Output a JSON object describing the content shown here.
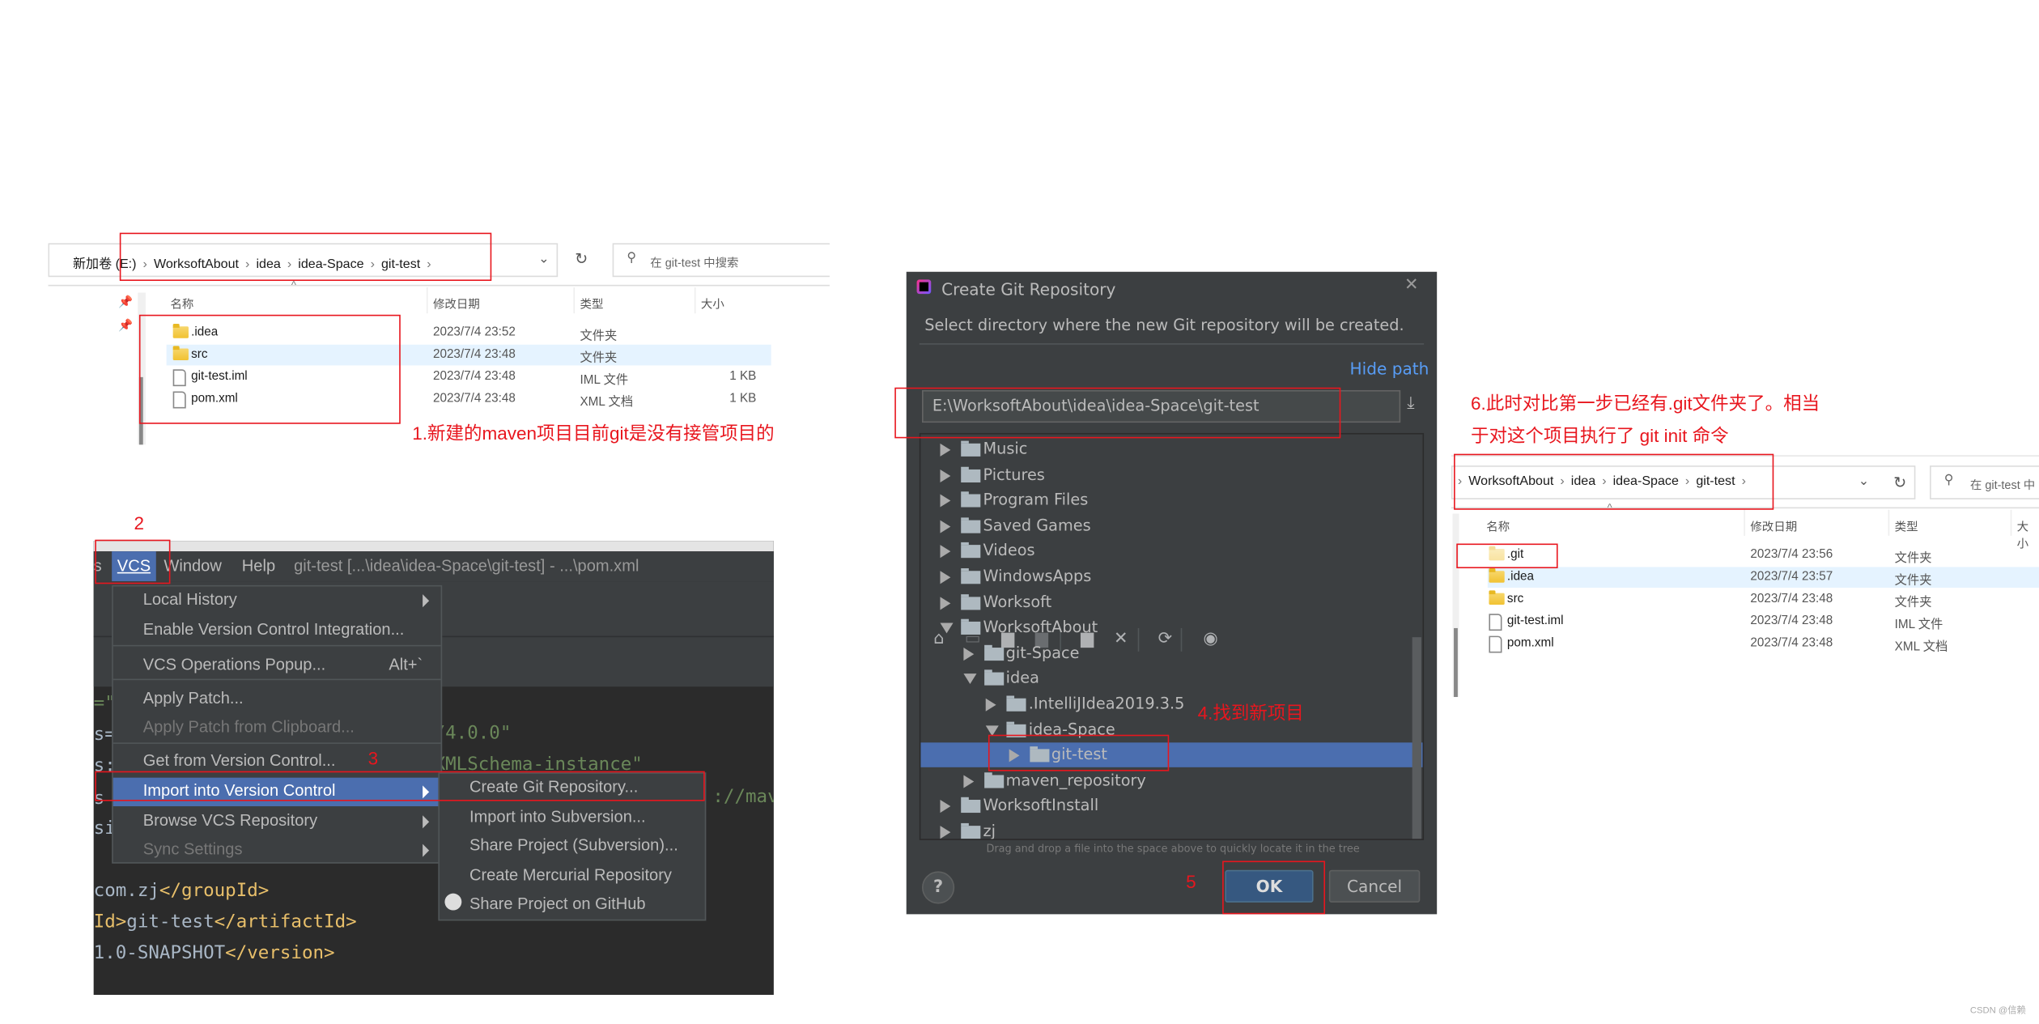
{
  "explorer_before": {
    "breadcrumb": [
      "新加卷 (E:)",
      "WorksoftAbout",
      "idea",
      "idea-Space",
      "git-test"
    ],
    "search_placeholder": "在 git-test 中搜索",
    "columns": [
      "名称",
      "修改日期",
      "类型",
      "大小"
    ],
    "rows": [
      {
        "name": ".idea",
        "date": "2023/7/4 23:52",
        "type": "文件夹",
        "size": "",
        "icon": "folder-icon",
        "selected": false
      },
      {
        "name": "src",
        "date": "2023/7/4 23:48",
        "type": "文件夹",
        "size": "",
        "icon": "folder-icon",
        "selected": true
      },
      {
        "name": "git-test.iml",
        "date": "2023/7/4 23:48",
        "type": "IML 文件",
        "size": "1 KB",
        "icon": "file-icon",
        "selected": false
      },
      {
        "name": "pom.xml",
        "date": "2023/7/4 23:48",
        "type": "XML 文档",
        "size": "1 KB",
        "icon": "file-icon",
        "selected": false
      }
    ]
  },
  "annotations": {
    "step1": "1.新建的maven项目目前git是没有接管项目的",
    "step2": "2",
    "step3": "3",
    "step4": "4.找到新项目",
    "step5": "5",
    "step6_line1": "6.此时对比第一步已经有.git文件夹了。相当",
    "step6_line2": "于对这个项目执行了 git init 命令",
    "color": "#e8161e"
  },
  "ide": {
    "menu_bar": [
      "s",
      "VCS",
      "Window",
      "Help"
    ],
    "window_title": "git-test [...\\idea\\idea-Space\\git-test] - ...\\pom.xml",
    "vcs_menu": [
      {
        "label": "Local History",
        "submenu": true,
        "disabled": false
      },
      {
        "label": "Enable Version Control Integration...",
        "submenu": false,
        "disabled": false
      },
      {
        "label": "VCS Operations Popup...",
        "shortcut": "Alt+`",
        "submenu": false,
        "disabled": false
      },
      {
        "label": "Apply Patch...",
        "submenu": false,
        "disabled": false
      },
      {
        "label": "Apply Patch from Clipboard...",
        "submenu": false,
        "disabled": true
      },
      {
        "label": "Get from Version Control...",
        "submenu": false,
        "disabled": false
      },
      {
        "label": "Import into Version Control",
        "submenu": true,
        "disabled": false,
        "highlighted": true
      },
      {
        "label": "Browse VCS Repository",
        "submenu": true,
        "disabled": false
      },
      {
        "label": "Sync Settings",
        "submenu": true,
        "disabled": true
      }
    ],
    "import_submenu": [
      {
        "label": "Create Git Repository..."
      },
      {
        "label": "Import into Subversion..."
      },
      {
        "label": "Share Project (Subversion)..."
      },
      {
        "label": "Create Mercurial Repository"
      },
      {
        "label": "Share Project on GitHub",
        "icon": "github-icon"
      }
    ],
    "code_fragments": {
      "left": [
        "=\"",
        "s=",
        "s:",
        "s",
        "si"
      ],
      "right": [
        "/4.0.0\"",
        "XMLSchema-instance\"",
        "://mav"
      ],
      "lines": [
        {
          "text": "com.zj",
          "tag": "</groupId>"
        },
        {
          "tag_open": "Id>",
          "text": "git-test",
          "tag": "</artifactId>"
        },
        {
          "text": "1.0-SNAPSHOT",
          "tag": "</version>"
        }
      ]
    },
    "colors": {
      "highlight": "#4b6eaf",
      "tag": "#e8bf6a",
      "string": "#6a8759",
      "text": "#a9b7c6"
    }
  },
  "dialog": {
    "title": "Create Git Repository",
    "subtitle": "Select directory where the new Git repository will be created.",
    "hide_path": "Hide path",
    "path": "E:\\WorksoftAbout\\idea\\idea-Space\\git-test",
    "toolbar_icons": [
      "home-icon",
      "desktop-icon",
      "project-folder-icon",
      "module-folder-icon",
      "new-folder-icon",
      "delete-icon",
      "refresh-icon",
      "show-hidden-icon"
    ],
    "tree": [
      {
        "label": "Music",
        "level": 0,
        "expanded": false
      },
      {
        "label": "Pictures",
        "level": 0,
        "expanded": false
      },
      {
        "label": "Program Files",
        "level": 0,
        "expanded": false
      },
      {
        "label": "Saved Games",
        "level": 0,
        "expanded": false
      },
      {
        "label": "Videos",
        "level": 0,
        "expanded": false
      },
      {
        "label": "WindowsApps",
        "level": 0,
        "expanded": false
      },
      {
        "label": "Worksoft",
        "level": 0,
        "expanded": false
      },
      {
        "label": "WorksoftAbout",
        "level": 0,
        "expanded": true
      },
      {
        "label": "git-Space",
        "level": 1,
        "expanded": false
      },
      {
        "label": "idea",
        "level": 1,
        "expanded": true
      },
      {
        "label": ".IntelliJIdea2019.3.5",
        "level": 2,
        "expanded": false
      },
      {
        "label": "idea-Space",
        "level": 2,
        "expanded": true
      },
      {
        "label": "git-test",
        "level": 3,
        "expanded": false,
        "selected": true
      },
      {
        "label": "maven_repository",
        "level": 1,
        "expanded": false
      },
      {
        "label": "WorksoftInstall",
        "level": 0,
        "expanded": false
      },
      {
        "label": "zj",
        "level": 0,
        "expanded": false
      }
    ],
    "hint": "Drag and drop a file into the space above to quickly locate it in the tree",
    "ok": "OK",
    "cancel": "Cancel",
    "help": "?",
    "colors": {
      "link": "#589df6",
      "selection": "#4b6eaf",
      "ok_button": "#365880"
    }
  },
  "explorer_after": {
    "breadcrumb": [
      "WorksoftAbout",
      "idea",
      "idea-Space",
      "git-test"
    ],
    "search_placeholder": "在 git-test 中",
    "columns": [
      "名称",
      "修改日期",
      "类型",
      "大小"
    ],
    "rows": [
      {
        "name": ".git",
        "date": "2023/7/4 23:56",
        "type": "文件夹",
        "icon": "folder-icon",
        "selected": false,
        "faded": true
      },
      {
        "name": ".idea",
        "date": "2023/7/4 23:57",
        "type": "文件夹",
        "icon": "folder-icon",
        "selected": true
      },
      {
        "name": "src",
        "date": "2023/7/4 23:48",
        "type": "文件夹",
        "icon": "folder-icon",
        "selected": false
      },
      {
        "name": "git-test.iml",
        "date": "2023/7/4 23:48",
        "type": "IML 文件",
        "icon": "file-icon",
        "selected": false
      },
      {
        "name": "pom.xml",
        "date": "2023/7/4 23:48",
        "type": "XML 文档",
        "icon": "file-icon",
        "selected": false
      }
    ]
  },
  "watermark": "CSDN @信赖"
}
